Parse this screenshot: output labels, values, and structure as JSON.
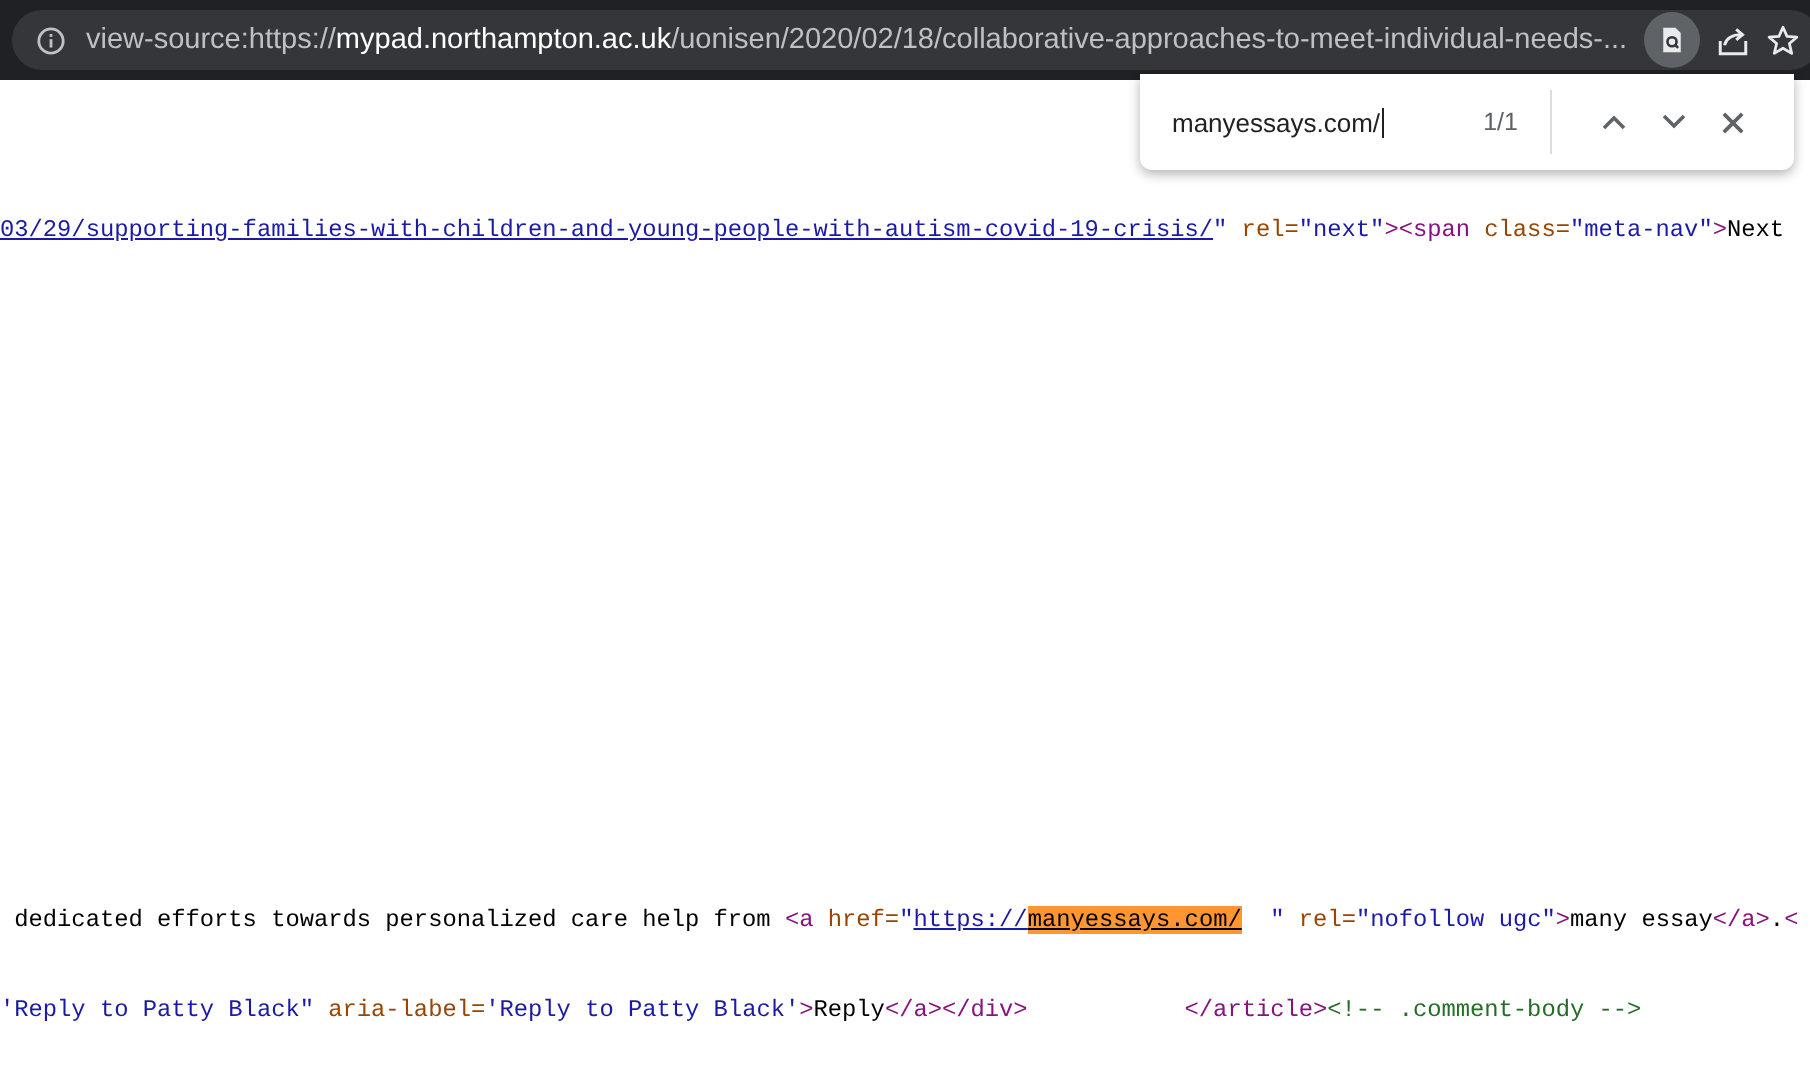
{
  "address_bar": {
    "scheme": "view-source:https://",
    "host": "mypad.northampton.ac.uk",
    "path": "/uonisen/2020/02/18/collaborative-approaches-to-meet-individual-needs-...",
    "find_active": true,
    "bookmarked": false
  },
  "find_bar": {
    "query": "manyessays.com/",
    "match_count": "1/1"
  },
  "source_lines": [
    {
      "tokens": [
        {
          "kind": "link",
          "text": "03/29/supporting-families-with-children-and-young-people-with-autism-covid-19-crisis/"
        },
        {
          "kind": "value",
          "text": "\""
        },
        {
          "kind": "attr",
          "text": " rel="
        },
        {
          "kind": "value",
          "text": "\"next\""
        },
        {
          "kind": "tag",
          "text": "><span"
        },
        {
          "kind": "attr",
          "text": " class="
        },
        {
          "kind": "value",
          "text": "\"meta-nav\""
        },
        {
          "kind": "tag",
          "text": ">"
        },
        {
          "kind": "text",
          "text": "Next"
        }
      ]
    },
    {
      "tokens": [
        {
          "kind": "text",
          "text": " dedicated efforts towards personalized care help from "
        },
        {
          "kind": "tag",
          "text": "<a"
        },
        {
          "kind": "attr",
          "text": " href="
        },
        {
          "kind": "value",
          "text": "\""
        },
        {
          "kind": "link",
          "text": "https://"
        },
        {
          "kind": "match",
          "text": "manyessays.com/"
        },
        {
          "kind": "value",
          "text": "  \""
        },
        {
          "kind": "attr",
          "text": " rel="
        },
        {
          "kind": "value",
          "text": "\"nofollow ugc\""
        },
        {
          "kind": "tag",
          "text": ">"
        },
        {
          "kind": "text",
          "text": "many essay"
        },
        {
          "kind": "tag",
          "text": "</a>"
        },
        {
          "kind": "text",
          "text": "."
        },
        {
          "kind": "tag",
          "text": "<"
        }
      ]
    },
    {
      "tokens": [
        {
          "kind": "value",
          "text": "'Reply to Patty Black\""
        },
        {
          "kind": "attr",
          "text": " aria-label="
        },
        {
          "kind": "value",
          "text": "'Reply to Patty Black'"
        },
        {
          "kind": "tag",
          "text": ">"
        },
        {
          "kind": "text",
          "text": "Reply"
        },
        {
          "kind": "tag",
          "text": "</a></div>"
        },
        {
          "kind": "tag",
          "text": "           </article>"
        },
        {
          "kind": "comment",
          "text": "<!-- .comment-body -->"
        }
      ]
    }
  ]
}
